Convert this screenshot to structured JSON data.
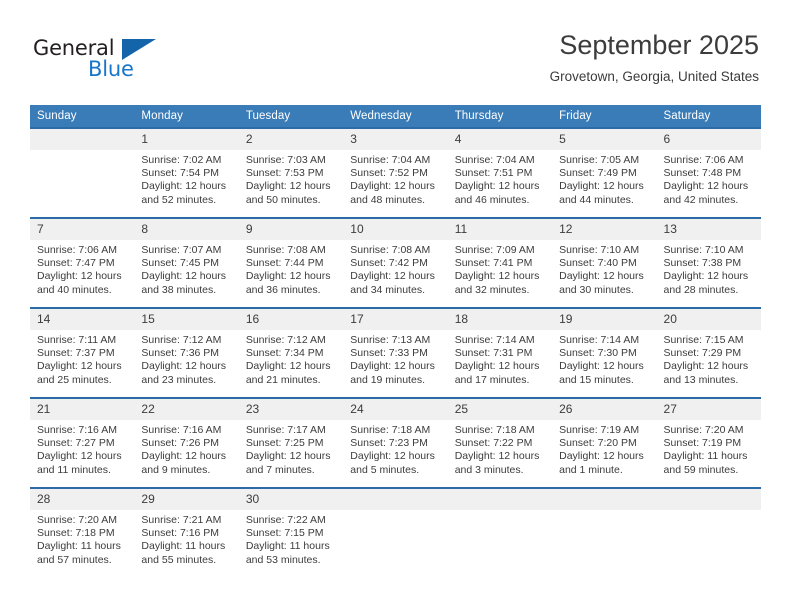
{
  "brand": {
    "name_dark": "General",
    "name_blue": "Blue",
    "color_blue": "#1876c8",
    "color_triangle": "#1464aa"
  },
  "header": {
    "title": "September 2025",
    "location": "Grovetown, Georgia, United States"
  },
  "theme": {
    "header_bg": "#3a7cb8",
    "row_divider": "#2b6ca8",
    "daynum_bg": "#f0f0f0",
    "text": "#3c3c3c"
  },
  "weekdays": [
    "Sunday",
    "Monday",
    "Tuesday",
    "Wednesday",
    "Thursday",
    "Friday",
    "Saturday"
  ],
  "weeks": [
    [
      {
        "day": "",
        "lines": []
      },
      {
        "day": "1",
        "lines": [
          "Sunrise: 7:02 AM",
          "Sunset: 7:54 PM",
          "Daylight: 12 hours",
          "and 52 minutes."
        ]
      },
      {
        "day": "2",
        "lines": [
          "Sunrise: 7:03 AM",
          "Sunset: 7:53 PM",
          "Daylight: 12 hours",
          "and 50 minutes."
        ]
      },
      {
        "day": "3",
        "lines": [
          "Sunrise: 7:04 AM",
          "Sunset: 7:52 PM",
          "Daylight: 12 hours",
          "and 48 minutes."
        ]
      },
      {
        "day": "4",
        "lines": [
          "Sunrise: 7:04 AM",
          "Sunset: 7:51 PM",
          "Daylight: 12 hours",
          "and 46 minutes."
        ]
      },
      {
        "day": "5",
        "lines": [
          "Sunrise: 7:05 AM",
          "Sunset: 7:49 PM",
          "Daylight: 12 hours",
          "and 44 minutes."
        ]
      },
      {
        "day": "6",
        "lines": [
          "Sunrise: 7:06 AM",
          "Sunset: 7:48 PM",
          "Daylight: 12 hours",
          "and 42 minutes."
        ]
      }
    ],
    [
      {
        "day": "7",
        "lines": [
          "Sunrise: 7:06 AM",
          "Sunset: 7:47 PM",
          "Daylight: 12 hours",
          "and 40 minutes."
        ]
      },
      {
        "day": "8",
        "lines": [
          "Sunrise: 7:07 AM",
          "Sunset: 7:45 PM",
          "Daylight: 12 hours",
          "and 38 minutes."
        ]
      },
      {
        "day": "9",
        "lines": [
          "Sunrise: 7:08 AM",
          "Sunset: 7:44 PM",
          "Daylight: 12 hours",
          "and 36 minutes."
        ]
      },
      {
        "day": "10",
        "lines": [
          "Sunrise: 7:08 AM",
          "Sunset: 7:42 PM",
          "Daylight: 12 hours",
          "and 34 minutes."
        ]
      },
      {
        "day": "11",
        "lines": [
          "Sunrise: 7:09 AM",
          "Sunset: 7:41 PM",
          "Daylight: 12 hours",
          "and 32 minutes."
        ]
      },
      {
        "day": "12",
        "lines": [
          "Sunrise: 7:10 AM",
          "Sunset: 7:40 PM",
          "Daylight: 12 hours",
          "and 30 minutes."
        ]
      },
      {
        "day": "13",
        "lines": [
          "Sunrise: 7:10 AM",
          "Sunset: 7:38 PM",
          "Daylight: 12 hours",
          "and 28 minutes."
        ]
      }
    ],
    [
      {
        "day": "14",
        "lines": [
          "Sunrise: 7:11 AM",
          "Sunset: 7:37 PM",
          "Daylight: 12 hours",
          "and 25 minutes."
        ]
      },
      {
        "day": "15",
        "lines": [
          "Sunrise: 7:12 AM",
          "Sunset: 7:36 PM",
          "Daylight: 12 hours",
          "and 23 minutes."
        ]
      },
      {
        "day": "16",
        "lines": [
          "Sunrise: 7:12 AM",
          "Sunset: 7:34 PM",
          "Daylight: 12 hours",
          "and 21 minutes."
        ]
      },
      {
        "day": "17",
        "lines": [
          "Sunrise: 7:13 AM",
          "Sunset: 7:33 PM",
          "Daylight: 12 hours",
          "and 19 minutes."
        ]
      },
      {
        "day": "18",
        "lines": [
          "Sunrise: 7:14 AM",
          "Sunset: 7:31 PM",
          "Daylight: 12 hours",
          "and 17 minutes."
        ]
      },
      {
        "day": "19",
        "lines": [
          "Sunrise: 7:14 AM",
          "Sunset: 7:30 PM",
          "Daylight: 12 hours",
          "and 15 minutes."
        ]
      },
      {
        "day": "20",
        "lines": [
          "Sunrise: 7:15 AM",
          "Sunset: 7:29 PM",
          "Daylight: 12 hours",
          "and 13 minutes."
        ]
      }
    ],
    [
      {
        "day": "21",
        "lines": [
          "Sunrise: 7:16 AM",
          "Sunset: 7:27 PM",
          "Daylight: 12 hours",
          "and 11 minutes."
        ]
      },
      {
        "day": "22",
        "lines": [
          "Sunrise: 7:16 AM",
          "Sunset: 7:26 PM",
          "Daylight: 12 hours",
          "and 9 minutes."
        ]
      },
      {
        "day": "23",
        "lines": [
          "Sunrise: 7:17 AM",
          "Sunset: 7:25 PM",
          "Daylight: 12 hours",
          "and 7 minutes."
        ]
      },
      {
        "day": "24",
        "lines": [
          "Sunrise: 7:18 AM",
          "Sunset: 7:23 PM",
          "Daylight: 12 hours",
          "and 5 minutes."
        ]
      },
      {
        "day": "25",
        "lines": [
          "Sunrise: 7:18 AM",
          "Sunset: 7:22 PM",
          "Daylight: 12 hours",
          "and 3 minutes."
        ]
      },
      {
        "day": "26",
        "lines": [
          "Sunrise: 7:19 AM",
          "Sunset: 7:20 PM",
          "Daylight: 12 hours",
          "and 1 minute."
        ]
      },
      {
        "day": "27",
        "lines": [
          "Sunrise: 7:20 AM",
          "Sunset: 7:19 PM",
          "Daylight: 11 hours",
          "and 59 minutes."
        ]
      }
    ],
    [
      {
        "day": "28",
        "lines": [
          "Sunrise: 7:20 AM",
          "Sunset: 7:18 PM",
          "Daylight: 11 hours",
          "and 57 minutes."
        ]
      },
      {
        "day": "29",
        "lines": [
          "Sunrise: 7:21 AM",
          "Sunset: 7:16 PM",
          "Daylight: 11 hours",
          "and 55 minutes."
        ]
      },
      {
        "day": "30",
        "lines": [
          "Sunrise: 7:22 AM",
          "Sunset: 7:15 PM",
          "Daylight: 11 hours",
          "and 53 minutes."
        ]
      },
      {
        "day": "",
        "lines": []
      },
      {
        "day": "",
        "lines": []
      },
      {
        "day": "",
        "lines": []
      },
      {
        "day": "",
        "lines": []
      }
    ]
  ]
}
